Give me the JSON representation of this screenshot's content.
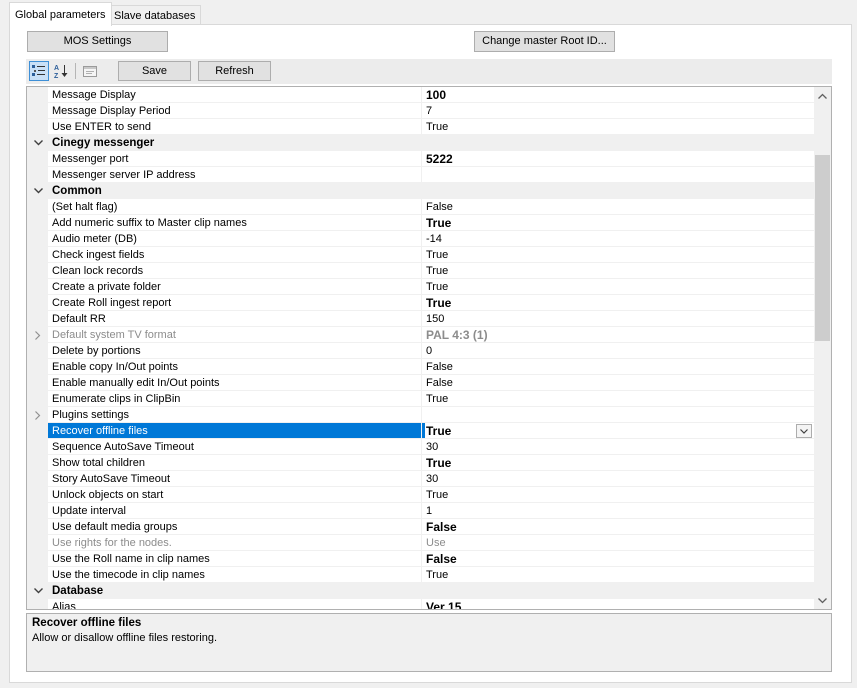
{
  "tabs": [
    {
      "label": "Global parameters",
      "active": true
    },
    {
      "label": "Slave databases",
      "active": false
    }
  ],
  "buttons": {
    "mos_settings": "MOS Settings",
    "change_root": "Change master Root ID...",
    "save": "Save",
    "refresh": "Refresh"
  },
  "toolbar_icons": [
    "categorized-icon",
    "alphabetical-sort-icon",
    "property-pages-icon"
  ],
  "grid": {
    "rows": [
      {
        "type": "prop",
        "name": "Message Display",
        "value": "100",
        "bold": true
      },
      {
        "type": "prop",
        "name": "Message Display Period",
        "value": "7"
      },
      {
        "type": "prop",
        "name": "Use ENTER to send",
        "value": "True"
      },
      {
        "type": "cat",
        "name": "Cinegy messenger"
      },
      {
        "type": "prop",
        "name": "Messenger port",
        "value": "5222",
        "bold": true
      },
      {
        "type": "prop",
        "name": "Messenger server IP address",
        "value": ""
      },
      {
        "type": "cat",
        "name": "Common"
      },
      {
        "type": "prop",
        "name": "(Set halt flag)",
        "value": "False"
      },
      {
        "type": "prop",
        "name": "Add numeric suffix to Master clip names",
        "value": "True",
        "bold": true
      },
      {
        "type": "prop",
        "name": "Audio meter (DB)",
        "value": "-14"
      },
      {
        "type": "prop",
        "name": "Check ingest fields",
        "value": "True"
      },
      {
        "type": "prop",
        "name": "Clean lock records",
        "value": "True"
      },
      {
        "type": "prop",
        "name": "Create a private folder",
        "value": "True"
      },
      {
        "type": "prop",
        "name": "Create Roll ingest report",
        "value": "True",
        "bold": true
      },
      {
        "type": "prop",
        "name": "Default RR",
        "value": "150"
      },
      {
        "type": "prop",
        "name": "Default system TV format",
        "value": "PAL 4:3 (1)",
        "bold": true,
        "disabled": true,
        "expandable": true
      },
      {
        "type": "prop",
        "name": "Delete by portions",
        "value": "0"
      },
      {
        "type": "prop",
        "name": "Enable copy In/Out points",
        "value": "False"
      },
      {
        "type": "prop",
        "name": "Enable manually edit In/Out points",
        "value": "False"
      },
      {
        "type": "prop",
        "name": "Enumerate clips in ClipBin",
        "value": "True"
      },
      {
        "type": "prop",
        "name": "Plugins settings",
        "value": "",
        "expandable": true
      },
      {
        "type": "prop",
        "name": "Recover offline files",
        "value": "True",
        "bold": true,
        "selected": true
      },
      {
        "type": "prop",
        "name": "Sequence AutoSave Timeout",
        "value": "30"
      },
      {
        "type": "prop",
        "name": "Show total children",
        "value": "True",
        "bold": true
      },
      {
        "type": "prop",
        "name": "Story AutoSave Timeout",
        "value": "30"
      },
      {
        "type": "prop",
        "name": "Unlock objects on start",
        "value": "True"
      },
      {
        "type": "prop",
        "name": "Update interval",
        "value": "1"
      },
      {
        "type": "prop",
        "name": "Use default media groups",
        "value": "False",
        "bold": true
      },
      {
        "type": "prop",
        "name": "Use rights for the nodes.",
        "value": "Use",
        "disabled": true
      },
      {
        "type": "prop",
        "name": "Use the Roll name in clip names",
        "value": "False",
        "bold": true
      },
      {
        "type": "prop",
        "name": "Use the timecode in clip names",
        "value": "True"
      },
      {
        "type": "cat",
        "name": "Database"
      },
      {
        "type": "prop",
        "name": "Alias",
        "value": "Ver 15",
        "bold": true
      }
    ]
  },
  "help": {
    "title": "Recover offline files",
    "description": "Allow or disallow offline files restoring."
  },
  "colors": {
    "selection": "#0078d7",
    "category_bg": "#f0f0f0"
  }
}
